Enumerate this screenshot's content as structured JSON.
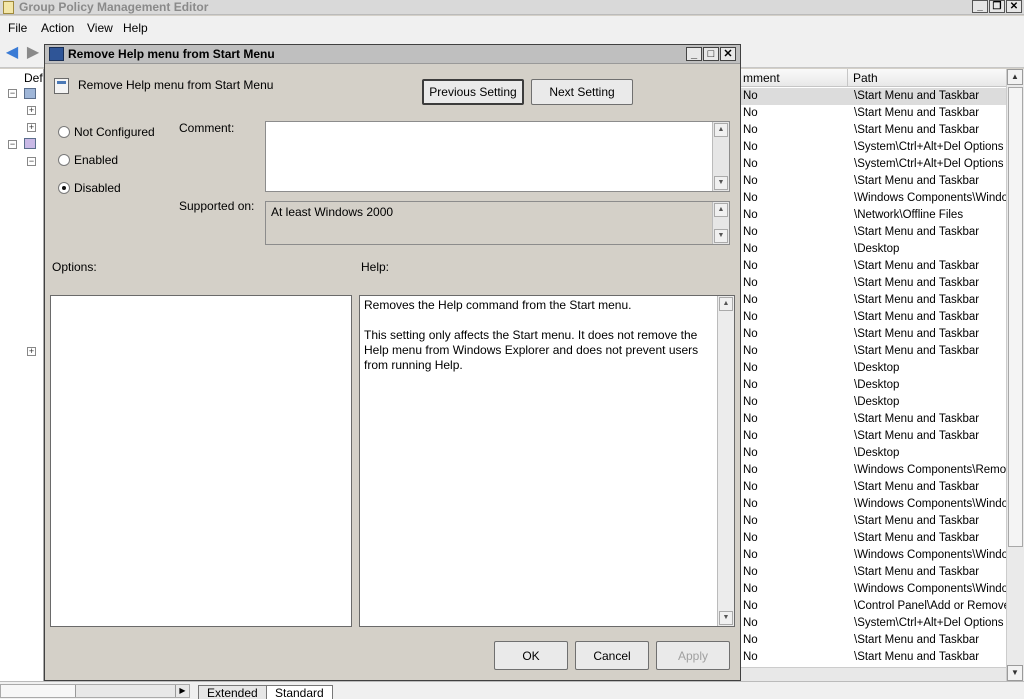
{
  "app": {
    "title": "Group Policy Management Editor"
  },
  "menu": [
    "File",
    "Action",
    "View",
    "Help"
  ],
  "tree": {
    "root_label": "Defa"
  },
  "list": {
    "columns": [
      "Comment",
      "Path"
    ],
    "header_visible": [
      "mment",
      "Path"
    ],
    "rows": [
      [
        "No",
        "\\Start Menu and Taskbar"
      ],
      [
        "No",
        "\\Start Menu and Taskbar"
      ],
      [
        "No",
        "\\Start Menu and Taskbar"
      ],
      [
        "No",
        "\\System\\Ctrl+Alt+Del Options"
      ],
      [
        "No",
        "\\System\\Ctrl+Alt+Del Options"
      ],
      [
        "No",
        "\\Start Menu and Taskbar"
      ],
      [
        "No",
        "\\Windows Components\\Window"
      ],
      [
        "No",
        "\\Network\\Offline Files"
      ],
      [
        "No",
        "\\Start Menu and Taskbar"
      ],
      [
        "No",
        "\\Desktop"
      ],
      [
        "No",
        "\\Start Menu and Taskbar"
      ],
      [
        "No",
        "\\Start Menu and Taskbar"
      ],
      [
        "No",
        "\\Start Menu and Taskbar"
      ],
      [
        "No",
        "\\Start Menu and Taskbar"
      ],
      [
        "No",
        "\\Start Menu and Taskbar"
      ],
      [
        "No",
        "\\Start Menu and Taskbar"
      ],
      [
        "No",
        "\\Desktop"
      ],
      [
        "No",
        "\\Desktop"
      ],
      [
        "No",
        "\\Desktop"
      ],
      [
        "No",
        "\\Start Menu and Taskbar"
      ],
      [
        "No",
        "\\Start Menu and Taskbar"
      ],
      [
        "No",
        "\\Desktop"
      ],
      [
        "No",
        "\\Windows Components\\Remote"
      ],
      [
        "No",
        "\\Start Menu and Taskbar"
      ],
      [
        "No",
        "\\Windows Components\\Window"
      ],
      [
        "No",
        "\\Start Menu and Taskbar"
      ],
      [
        "No",
        "\\Start Menu and Taskbar"
      ],
      [
        "No",
        "\\Windows Components\\Window"
      ],
      [
        "No",
        "\\Start Menu and Taskbar"
      ],
      [
        "No",
        "\\Windows Components\\Window"
      ],
      [
        "No",
        "\\Control Panel\\Add or Remove P"
      ],
      [
        "No",
        "\\System\\Ctrl+Alt+Del Options"
      ],
      [
        "No",
        "\\Start Menu and Taskbar"
      ],
      [
        "No",
        "\\Start Menu and Taskbar"
      ]
    ]
  },
  "bottom_tabs": [
    "Extended",
    "Standard"
  ],
  "dialog": {
    "title": "Remove Help menu from Start Menu",
    "setting_name": "Remove Help menu from Start Menu",
    "prev_button": "Previous Setting",
    "next_button": "Next Setting",
    "radios": [
      {
        "label": "Not Configured",
        "checked": false
      },
      {
        "label": "Enabled",
        "checked": false
      },
      {
        "label": "Disabled",
        "checked": true
      }
    ],
    "comment_label": "Comment:",
    "comment_value": "",
    "supported_label": "Supported on:",
    "supported_value": "At least Windows 2000",
    "options_label": "Options:",
    "help_label": "Help:",
    "help_paragraphs": [
      "Removes the Help command from the Start menu.",
      "This setting only affects the Start menu. It does not remove the Help menu from Windows Explorer and does not prevent users from running Help."
    ],
    "ok_button": "OK",
    "cancel_button": "Cancel",
    "apply_button": "Apply"
  }
}
